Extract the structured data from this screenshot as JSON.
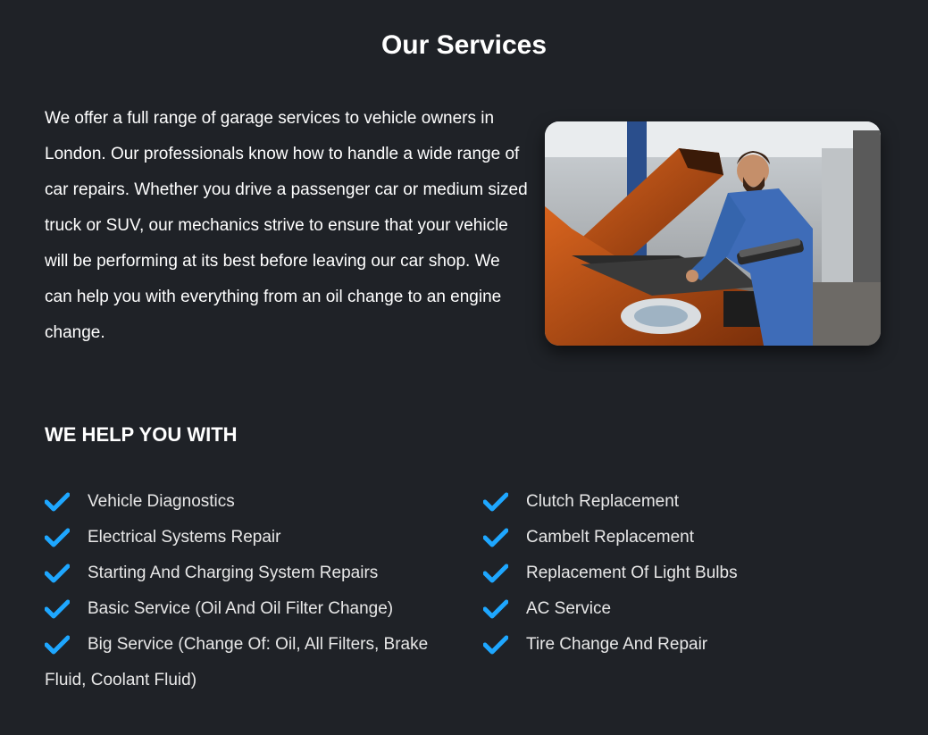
{
  "title": "Our Services",
  "intro": "We offer a full range of garage services to vehicle owners in London. Our professionals know how to handle a wide range of car repairs. Whether you drive a passenger car or medium sized truck or SUV, our mechanics strive to ensure that your vehicle will be performing at its best before leaving our car shop. We can help you with everything from an oil change to an engine change.",
  "photo_icon": "mechanic-photo",
  "help_heading": "WE HELP YOU WITH",
  "check_color": "#1ea7ff",
  "services_left": [
    "Vehicle Diagnostics",
    "Electrical Systems Repair",
    "Starting And Charging System Repairs",
    "Basic Service (Oil And Oil Filter Change)",
    "Big Service (Change Of: Oil, All Filters, Brake Fluid, Coolant Fluid)"
  ],
  "services_right": [
    "Clutch Replacement",
    "Cambelt Replacement",
    "Replacement Of Light Bulbs",
    "AC Service",
    "Tire Change And Repair"
  ]
}
